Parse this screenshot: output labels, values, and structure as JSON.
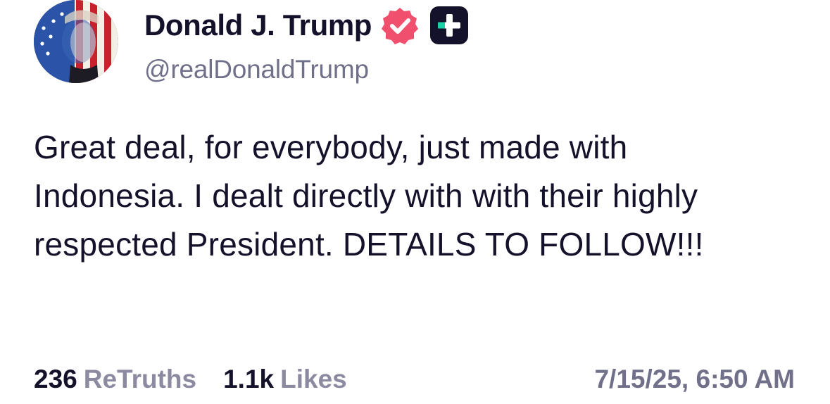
{
  "author": {
    "display_name": "Donald J. Trump",
    "handle": "@realDonaldTrump",
    "avatar_icon": "flag-portrait-avatar",
    "verified_icon": "verified-badge-icon",
    "plus_badge_icon": "plus-subscriber-badge-icon"
  },
  "post": {
    "text": "Great deal, for everybody, just made with Indonesia. I dealt directly with with their highly respected President. DETAILS TO FOLLOW!!!",
    "timestamp": "7/15/25, 6:50 AM"
  },
  "stats": {
    "retruths_count": "236",
    "retruths_label": "ReTruths",
    "likes_count": "1.1k",
    "likes_label": "Likes"
  },
  "colors": {
    "text_primary": "#14112b",
    "text_secondary": "#71708a",
    "verified_badge": "#f0506e",
    "plus_badge_bg": "#14112b",
    "plus_badge_accent": "#1ad1a5"
  }
}
